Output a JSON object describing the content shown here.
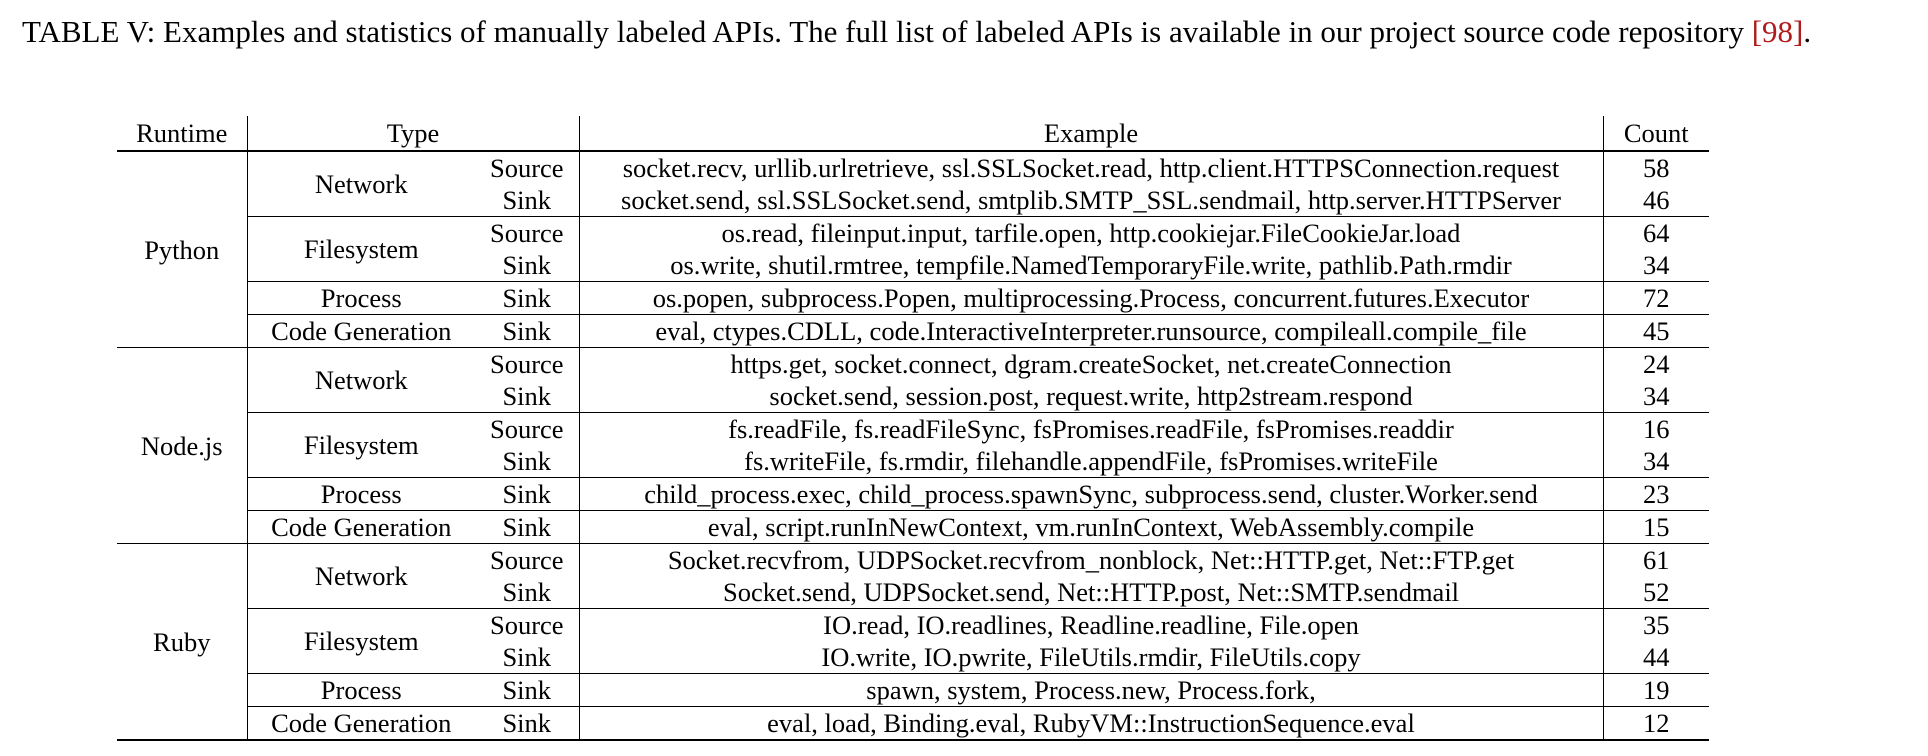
{
  "caption": {
    "text": "TABLE V: Examples and statistics of manually labeled APIs. The full list of labeled APIs is available in our project source code repository ",
    "ref": "[98]",
    "end": "."
  },
  "table": {
    "headers": {
      "runtime": "Runtime",
      "type": "Type",
      "example": "Example",
      "count": "Count"
    },
    "rows": [
      {
        "runtime": "Python",
        "type": "Network",
        "dir": "Source",
        "example": "socket.recv, urllib.urlretrieve, ssl.SSLSocket.read, http.client.HTTPSConnection.request",
        "count": "58"
      },
      {
        "dir": "Sink",
        "example": "socket.send, ssl.SSLSocket.send, smtplib.SMTP_SSL.sendmail, http.server.HTTPServer",
        "count": "46"
      },
      {
        "type": "Filesystem",
        "dir": "Source",
        "example": "os.read, fileinput.input, tarfile.open, http.cookiejar.FileCookieJar.load",
        "count": "64"
      },
      {
        "dir": "Sink",
        "example": "os.write, shutil.rmtree, tempfile.NamedTemporaryFile.write, pathlib.Path.rmdir",
        "count": "34"
      },
      {
        "type": "Process",
        "dir": "Sink",
        "example": "os.popen, subprocess.Popen, multiprocessing.Process, concurrent.futures.Executor",
        "count": "72"
      },
      {
        "type": "Code Generation",
        "dir": "Sink",
        "example": "eval, ctypes.CDLL, code.InteractiveInterpreter.runsource, compileall.compile_file",
        "count": "45"
      },
      {
        "runtime": "Node.js",
        "type": "Network",
        "dir": "Source",
        "example": "https.get, socket.connect, dgram.createSocket, net.createConnection",
        "count": "24"
      },
      {
        "dir": "Sink",
        "example": "socket.send, session.post, request.write, http2stream.respond",
        "count": "34"
      },
      {
        "type": "Filesystem",
        "dir": "Source",
        "example": "fs.readFile, fs.readFileSync, fsPromises.readFile, fsPromises.readdir",
        "count": "16"
      },
      {
        "dir": "Sink",
        "example": "fs.writeFile, fs.rmdir, filehandle.appendFile, fsPromises.writeFile",
        "count": "34"
      },
      {
        "type": "Process",
        "dir": "Sink",
        "example": "child_process.exec, child_process.spawnSync, subprocess.send, cluster.Worker.send",
        "count": "23"
      },
      {
        "type": "Code Generation",
        "dir": "Sink",
        "example": "eval, script.runInNewContext, vm.runInContext, WebAssembly.compile",
        "count": "15"
      },
      {
        "runtime": "Ruby",
        "type": "Network",
        "dir": "Source",
        "example": "Socket.recvfrom, UDPSocket.recvfrom_nonblock, Net::HTTP.get, Net::FTP.get",
        "count": "61"
      },
      {
        "dir": "Sink",
        "example": "Socket.send, UDPSocket.send, Net::HTTP.post, Net::SMTP.sendmail",
        "count": "52"
      },
      {
        "type": "Filesystem",
        "dir": "Source",
        "example": "IO.read, IO.readlines, Readline.readline, File.open",
        "count": "35"
      },
      {
        "dir": "Sink",
        "example": "IO.write, IO.pwrite, FileUtils.rmdir, FileUtils.copy",
        "count": "44"
      },
      {
        "type": "Process",
        "dir": "Sink",
        "example": "spawn, system, Process.new, Process.fork,",
        "count": "19"
      },
      {
        "type": "Code Generation",
        "dir": "Sink",
        "example": "eval, load, Binding.eval, RubyVM::InstructionSequence.eval",
        "count": "12"
      }
    ]
  }
}
